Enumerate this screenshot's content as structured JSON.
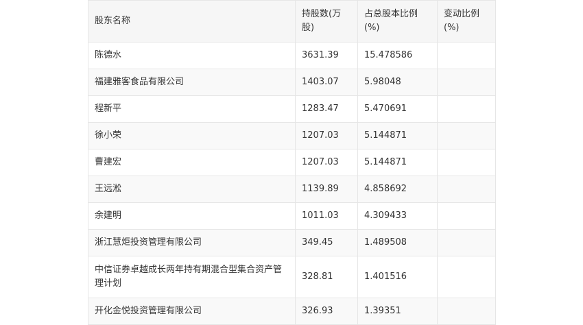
{
  "table": {
    "headers": [
      "股东名称",
      "持股数(万股)",
      "占总股本比例(%)",
      "变动比例(%)"
    ],
    "rows": [
      {
        "name": "陈德水",
        "shares": "3631.39",
        "ratio": "15.478586",
        "change": ""
      },
      {
        "name": "福建雅客食品有限公司",
        "shares": "1403.07",
        "ratio": "5.98048",
        "change": ""
      },
      {
        "name": "程新平",
        "shares": "1283.47",
        "ratio": "5.470691",
        "change": ""
      },
      {
        "name": "徐小荣",
        "shares": "1207.03",
        "ratio": "5.144871",
        "change": ""
      },
      {
        "name": "曹建宏",
        "shares": "1207.03",
        "ratio": "5.144871",
        "change": ""
      },
      {
        "name": "王远淞",
        "shares": "1139.89",
        "ratio": "4.858692",
        "change": ""
      },
      {
        "name": "余建明",
        "shares": "1011.03",
        "ratio": "4.309433",
        "change": ""
      },
      {
        "name": "浙江慧炬投资管理有限公司",
        "shares": "349.45",
        "ratio": "1.489508",
        "change": ""
      },
      {
        "name": "中信证券卓越成长两年持有期混合型集合资产管理计划",
        "shares": "328.81",
        "ratio": "1.401516",
        "change": ""
      },
      {
        "name": "开化金悦投资管理有限公司",
        "shares": "326.93",
        "ratio": "1.39351",
        "change": ""
      }
    ]
  }
}
